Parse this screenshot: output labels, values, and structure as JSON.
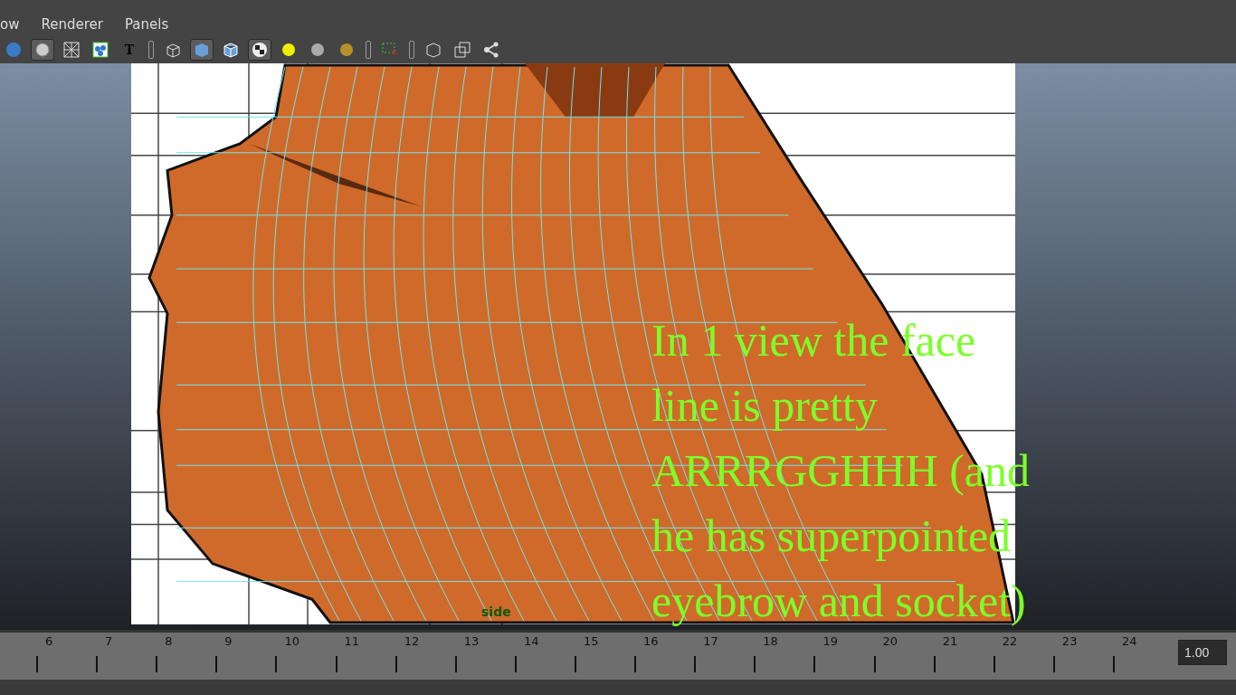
{
  "menu": [
    "ow",
    "Renderer",
    "Panels"
  ],
  "toolbar": [
    {
      "kind": "sphere",
      "selected": false
    },
    {
      "kind": "circle",
      "selected": true
    },
    {
      "kind": "wire",
      "selected": false
    },
    {
      "kind": "dots",
      "selected": false
    },
    {
      "kind": "text",
      "label": "T",
      "selected": false
    },
    {
      "kind": "sep"
    },
    {
      "kind": "wirecube",
      "selected": false
    },
    {
      "kind": "solidcube",
      "selected": true
    },
    {
      "kind": "cube",
      "selected": false
    },
    {
      "kind": "checker",
      "selected": true
    },
    {
      "kind": "light",
      "selected": false
    },
    {
      "kind": "grey",
      "selected": false
    },
    {
      "kind": "gold",
      "selected": false
    },
    {
      "kind": "sep"
    },
    {
      "kind": "select",
      "selected": false
    },
    {
      "kind": "sep"
    },
    {
      "kind": "box",
      "selected": false
    },
    {
      "kind": "squares",
      "selected": false
    },
    {
      "kind": "share",
      "selected": false
    }
  ],
  "viewport": {
    "camera_label": "side",
    "annotation": [
      "In 1 view the face",
      "line is pretty",
      "ARRRGGHHH (and",
      "he has superpointed",
      "eyebrow and socket)"
    ]
  },
  "timeline": {
    "frames": [
      "6",
      "7",
      "8",
      "9",
      "10",
      "11",
      "12",
      "13",
      "14",
      "15",
      "16",
      "17",
      "18",
      "19",
      "20",
      "21",
      "22",
      "23",
      "24"
    ],
    "current": "1.00"
  }
}
